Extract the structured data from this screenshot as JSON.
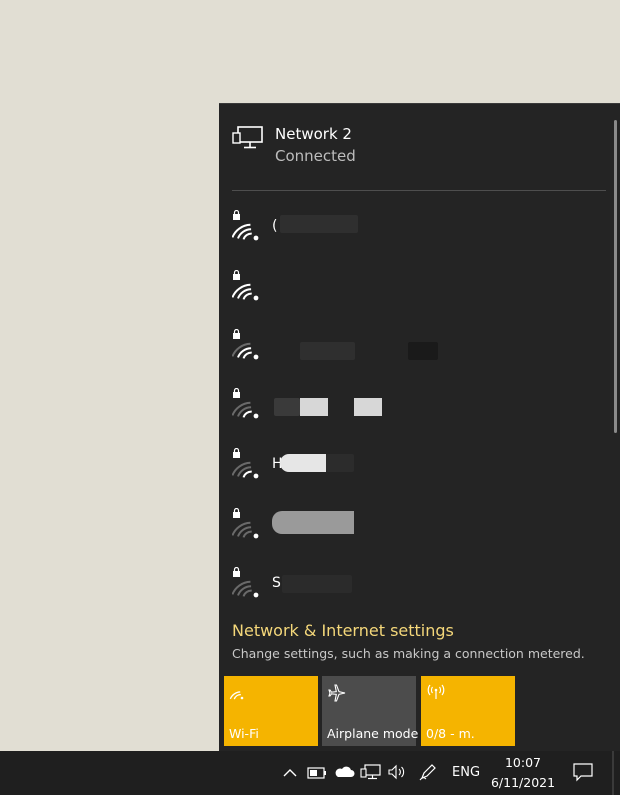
{
  "connected_network": {
    "name": "Network 2",
    "status": "Connected",
    "icon": "ethernet-monitor-icon"
  },
  "networks": [
    {
      "label": "(",
      "icon": "secured-wifi-icon"
    },
    {
      "label": "",
      "icon": "secured-wifi-icon"
    },
    {
      "label": "",
      "icon": "secured-wifi-icon"
    },
    {
      "label": "",
      "icon": "secured-wifi-icon"
    },
    {
      "label": "H",
      "icon": "secured-wifi-icon"
    },
    {
      "label": "",
      "icon": "secured-wifi-icon"
    },
    {
      "label": "S",
      "icon": "secured-wifi-icon"
    }
  ],
  "settings": {
    "title": "Network & Internet settings",
    "description": "Change settings, such as making a connection metered."
  },
  "tiles": [
    {
      "label": "Wi-Fi",
      "icon": "wifi-icon",
      "state": "on"
    },
    {
      "label": "Airplane mode",
      "icon": "airplane-icon",
      "state": "off"
    },
    {
      "label": "0/8 - m.",
      "icon": "mobile-hotspot-icon",
      "state": "on"
    }
  ],
  "taskbar": {
    "language": "ENG",
    "time": "10:07",
    "date": "6/11/2021",
    "icons": [
      "show-hidden-icons-chevron",
      "battery-icon",
      "onedrive-cloud-icon",
      "network-icon",
      "volume-icon",
      "pen-icon",
      "action-center-icon"
    ]
  },
  "colors": {
    "flyout_bg": "#242424",
    "accent": "#f5b400",
    "link": "#f4d77a",
    "desktop": "#e1ded3"
  }
}
